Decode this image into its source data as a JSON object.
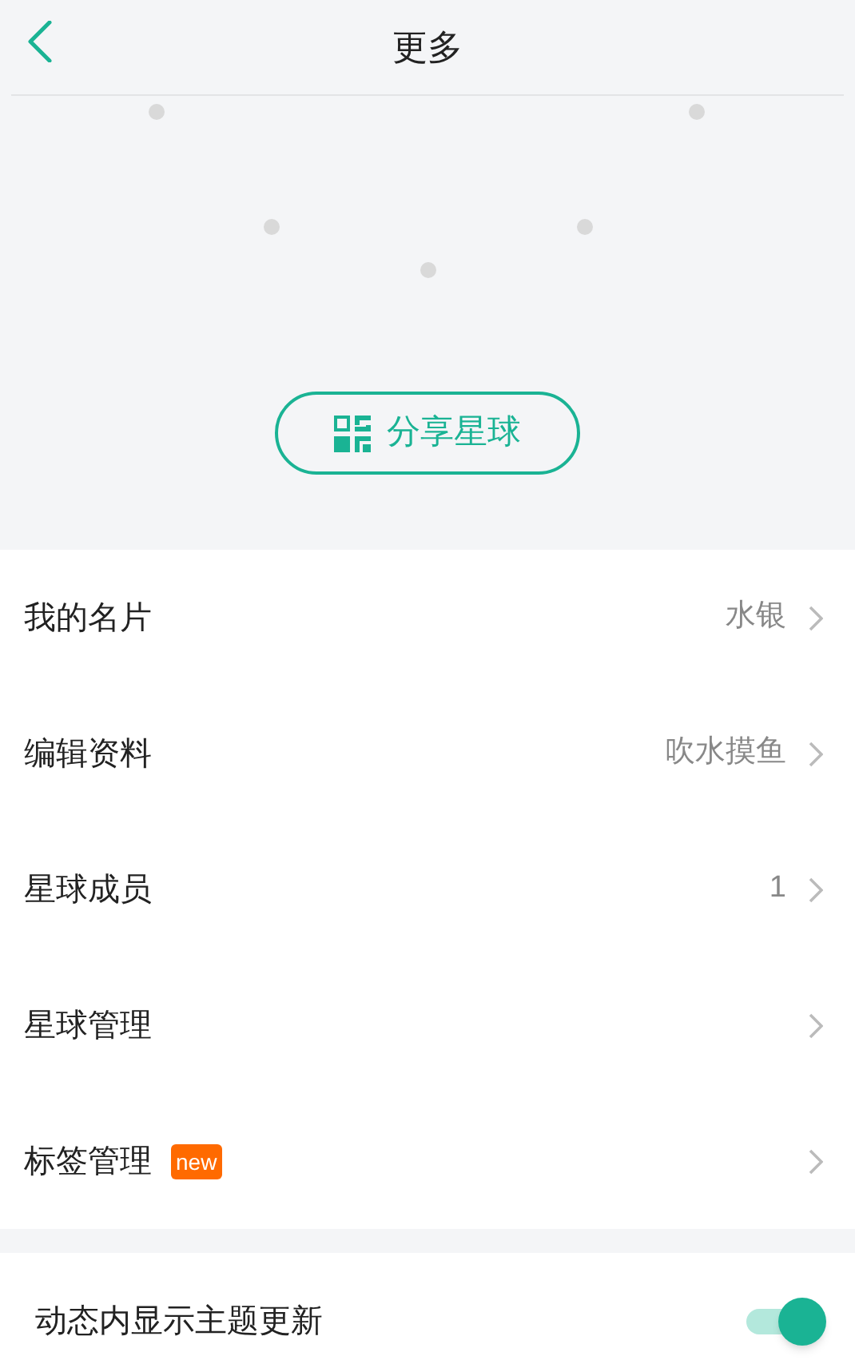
{
  "header": {
    "title": "更多"
  },
  "share_button": {
    "label": "分享星球"
  },
  "menu": [
    {
      "label": "我的名片",
      "value": "水银"
    },
    {
      "label": "编辑资料",
      "value": "吹水摸鱼"
    },
    {
      "label": "星球成员",
      "value": "1"
    },
    {
      "label": "星球管理"
    },
    {
      "label": "标签管理",
      "badge": "new"
    }
  ],
  "settings": [
    {
      "label": "动态内显示主题更新",
      "on": true
    }
  ]
}
